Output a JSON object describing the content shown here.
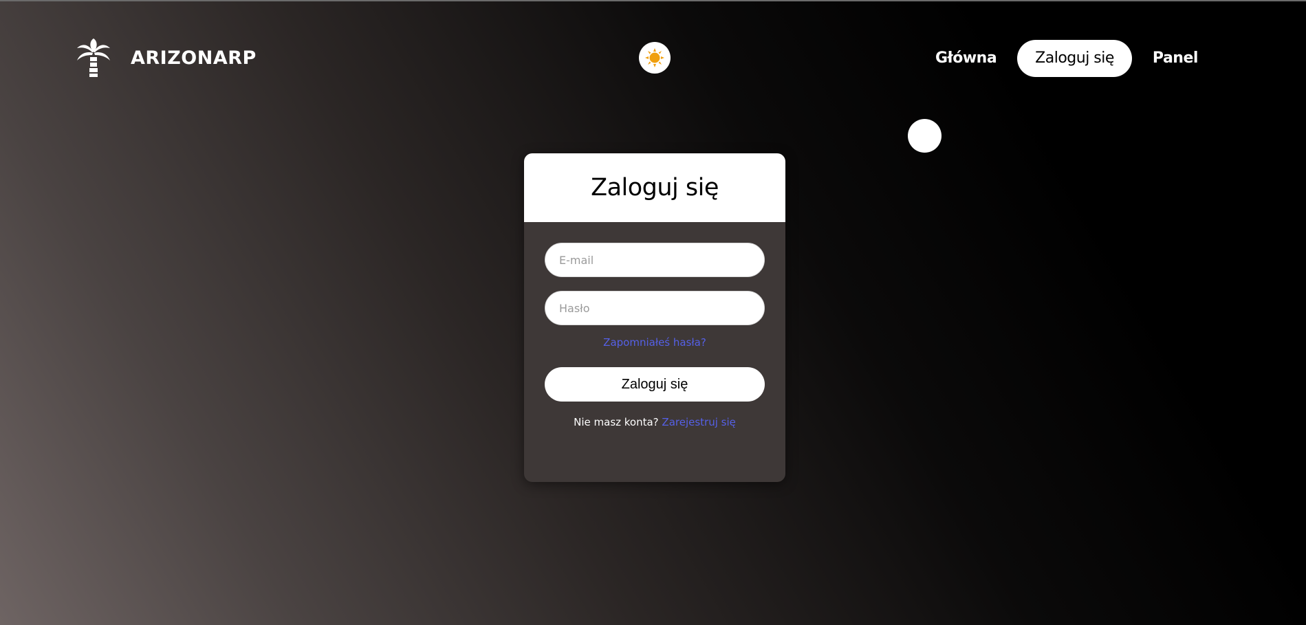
{
  "header": {
    "logo_icon": "palm-tree-icon",
    "brand": "ARIZONARP",
    "theme_toggle_icon": "sun-icon",
    "nav": [
      {
        "label": "Główna",
        "active": false
      },
      {
        "label": "Zaloguj się",
        "active": true
      },
      {
        "label": "Panel",
        "active": false
      }
    ]
  },
  "login": {
    "title": "Zaloguj się",
    "email_placeholder": "E-mail",
    "email_value": "",
    "password_placeholder": "Hasło",
    "password_value": "",
    "forgot_label": "Zapomniałeś hasła?",
    "submit_label": "Zaloguj się",
    "no_account_text": "Nie masz konta?",
    "register_label": "Zarejestruj się"
  },
  "colors": {
    "link": "#5560e6",
    "card_body": "#3e3837",
    "sun": "#f0a010"
  }
}
